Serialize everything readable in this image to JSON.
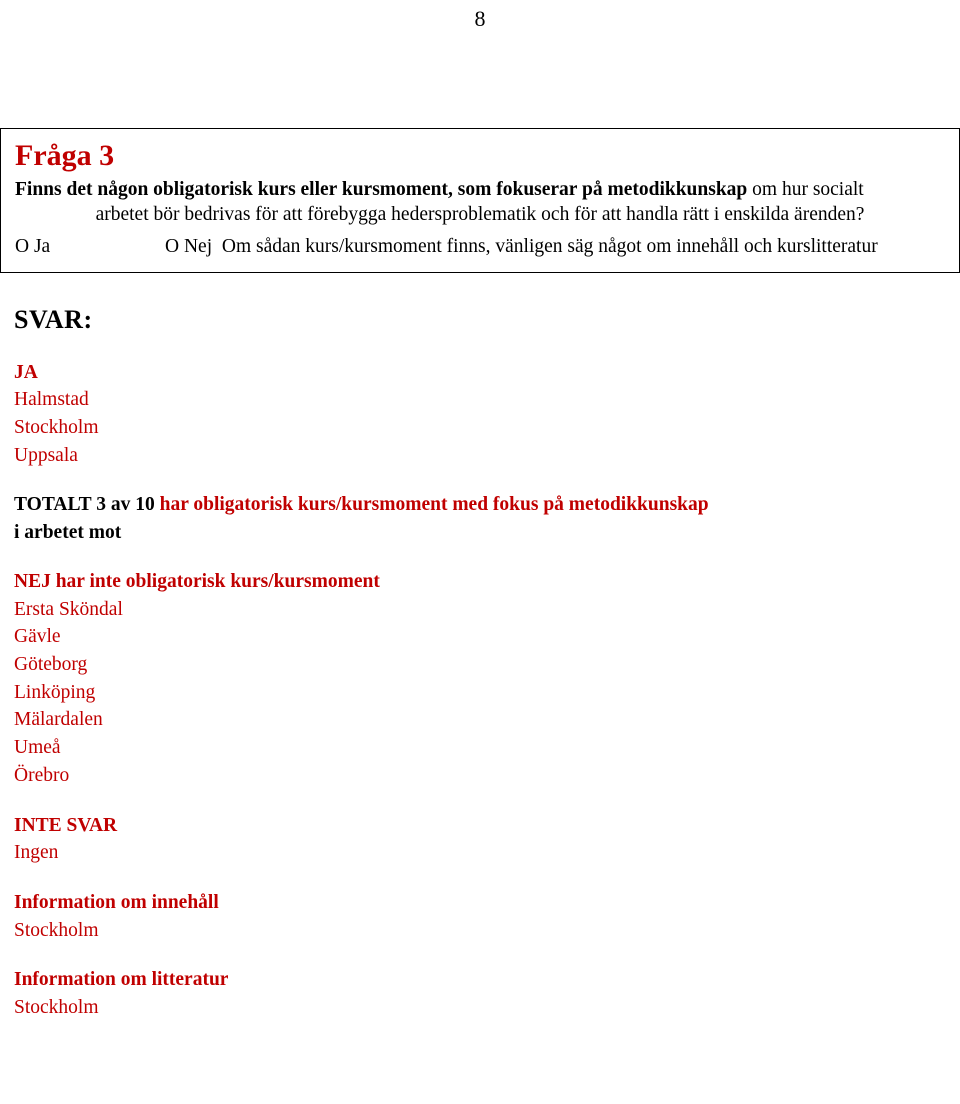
{
  "page": {
    "number": "8"
  },
  "question": {
    "title": "Fråga 3",
    "body_bold_1": "Finns det någon obligatorisk kurs eller kursmoment, som fokuserar på metodikkunskap",
    "body_rest_1": " om hur socialt",
    "body_line_2": "arbetet bör bedrivas för att förebygga hedersproblematik och för att handla rätt i enskilda ärenden?",
    "option_ja": "O Ja",
    "option_nej": "O  Nej",
    "option_note": "Om sådan kurs/kursmoment finns, vänligen säg något om innehåll och kurslitteratur"
  },
  "answer": {
    "heading": "SVAR:",
    "ja_label": "JA",
    "ja_items": [
      "Halmstad",
      "Stockholm",
      "Uppsala"
    ],
    "totalt_prefix": "TOTALT 3 av 10 ",
    "totalt_rest": "har obligatorisk kurs/kursmoment med fokus på metodikkunskap",
    "totalt_line2": "i arbetet mot",
    "nej_label": "NEJ har inte obligatorisk kurs/kursmoment",
    "nej_items": [
      "Ersta Sköndal",
      "Gävle",
      "Göteborg",
      "Linköping",
      "Mälardalen",
      "Umeå",
      "Örebro"
    ],
    "inte_svar_label": "INTE SVAR",
    "inte_svar_items": [
      "Ingen"
    ],
    "info_innehall_label": "Information  om innehåll",
    "info_innehall_items": [
      "Stockholm"
    ],
    "info_litteratur_label": "Information om litteratur",
    "info_litteratur_items": [
      "Stockholm"
    ]
  }
}
